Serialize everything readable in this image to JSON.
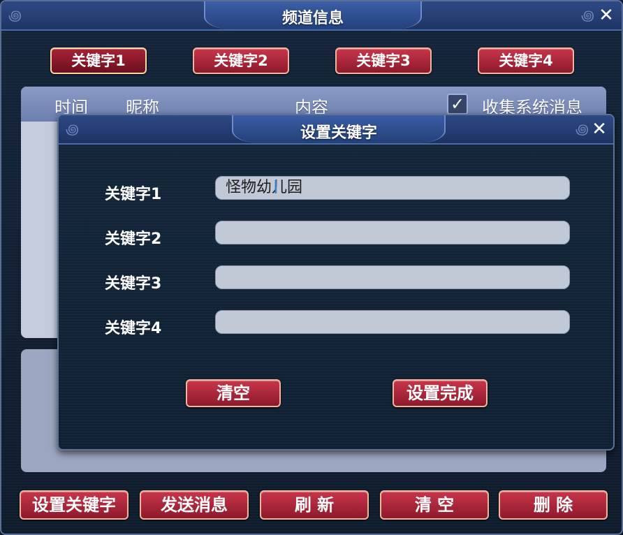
{
  "window": {
    "title": "频道信息",
    "close_symbol": "✕"
  },
  "keyword_tabs": [
    {
      "label": "关键字1",
      "selected": true
    },
    {
      "label": "关键字2",
      "selected": false
    },
    {
      "label": "关键字3",
      "selected": false
    },
    {
      "label": "关键字4",
      "selected": false
    }
  ],
  "message_table": {
    "columns": [
      "时间",
      "昵称",
      "内容"
    ],
    "collect_system": {
      "label": "收集系统消息",
      "checked": true,
      "check_symbol": "✓"
    }
  },
  "dialog": {
    "title": "设置关键字",
    "close_symbol": "✕",
    "rows": [
      {
        "label": "关键字1",
        "value": "怪物幼儿园"
      },
      {
        "label": "关键字2",
        "value": ""
      },
      {
        "label": "关键字3",
        "value": ""
      },
      {
        "label": "关键字4",
        "value": ""
      }
    ],
    "clear_label": "清空",
    "done_label": "设置完成"
  },
  "bottom_buttons": [
    {
      "label": "设置关键字"
    },
    {
      "label": "发送消息"
    },
    {
      "label": "刷 新"
    },
    {
      "label": "清 空"
    },
    {
      "label": "删 除"
    }
  ],
  "colors": {
    "button_red": "#c8354a",
    "title_blue": "#2e4a86",
    "panel_light": "#c4cbdd"
  }
}
